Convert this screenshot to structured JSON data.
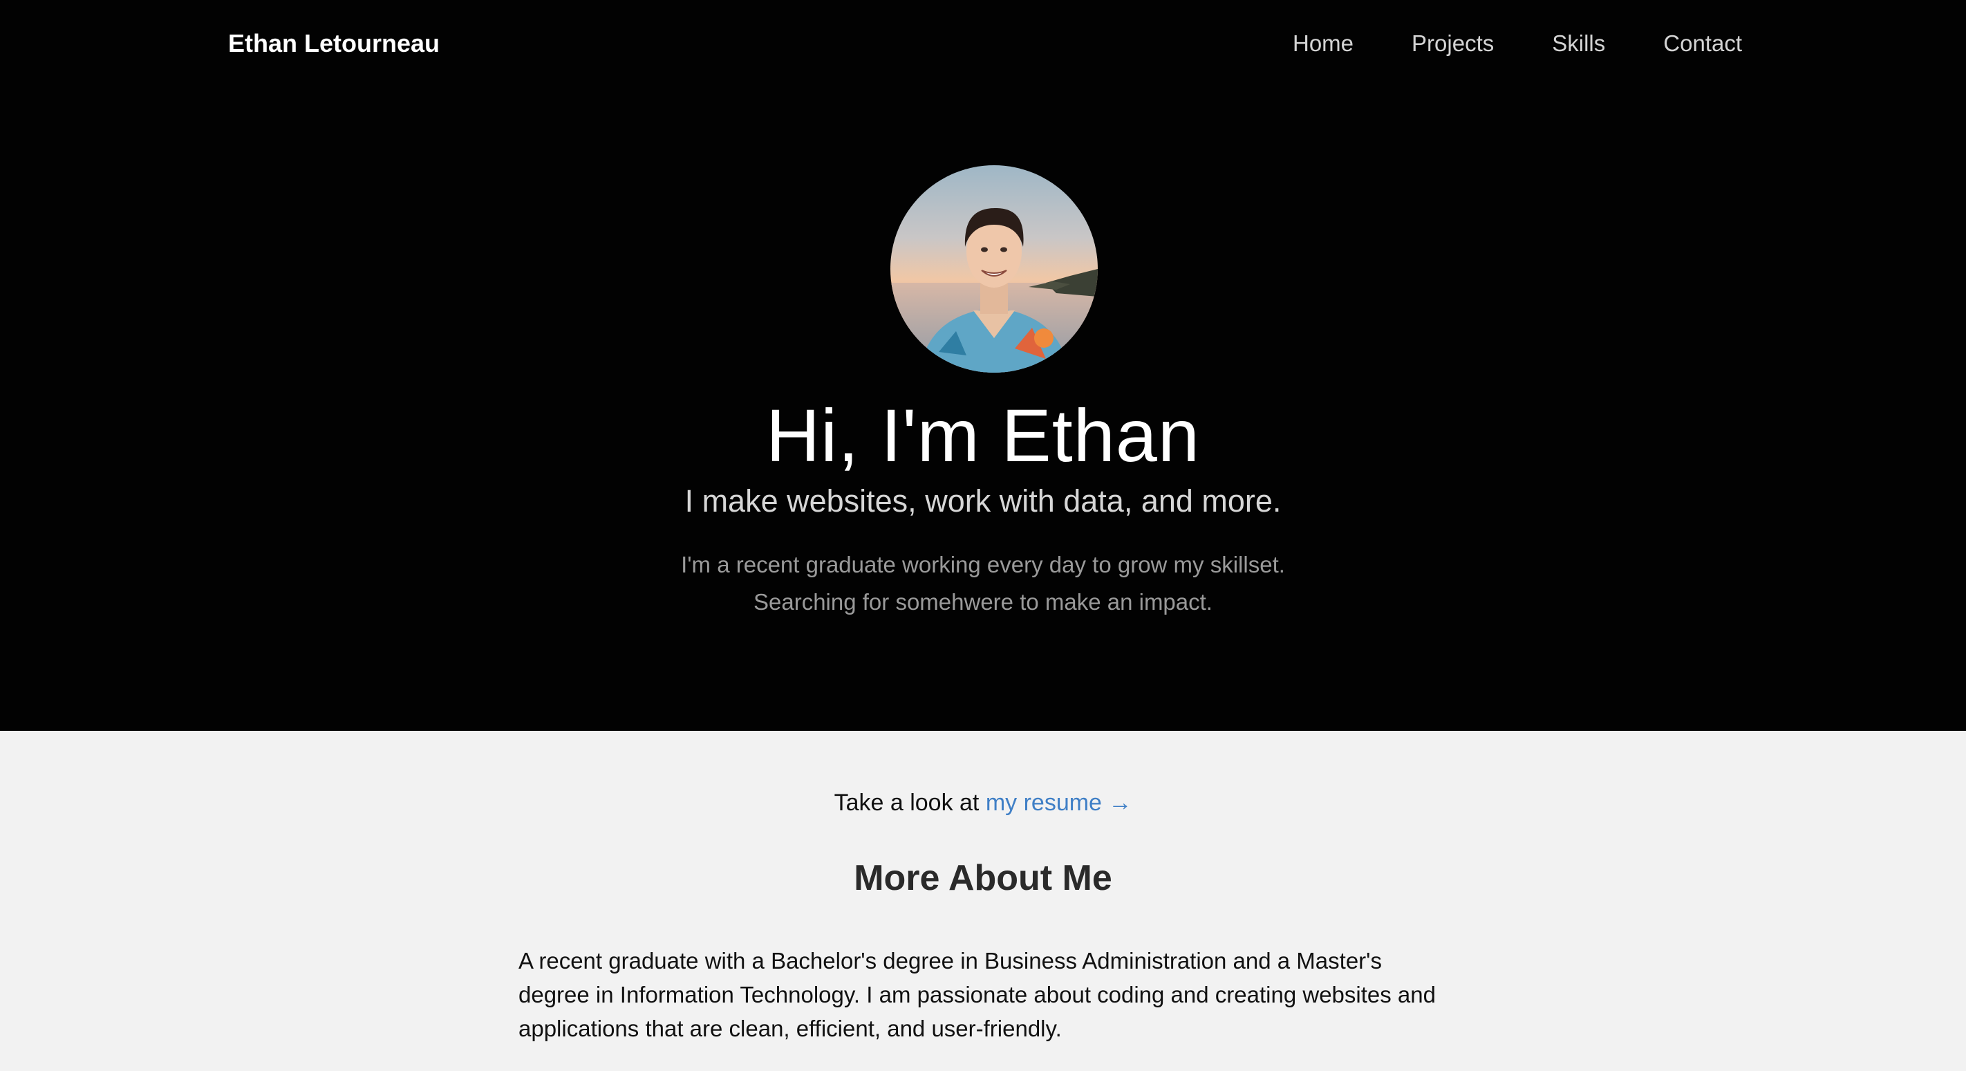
{
  "header": {
    "brand": "Ethan Letourneau",
    "nav": [
      "Home",
      "Projects",
      "Skills",
      "Contact"
    ]
  },
  "hero": {
    "avatar_alt": "Portrait of Ethan",
    "title": "Hi, I'm Ethan",
    "subtitle": "I make websites, work with data, and more.",
    "description_lines": [
      "I'm a recent graduate working every day to grow my skillset.",
      "Searching for somehwere to make an impact."
    ]
  },
  "resume": {
    "prefix": "Take a look at ",
    "link_label": "my resume →"
  },
  "about": {
    "title": "More About Me",
    "paragraph": "A recent graduate with a Bachelor's degree in Business Administration and a Master's degree in Information Technology. I am passionate about coding and creating websites and applications that are clean, efficient, and user-friendly."
  },
  "colors": {
    "hero_background": "#020202",
    "page_background": "#f2f2f2",
    "link": "#3f7fc6"
  }
}
